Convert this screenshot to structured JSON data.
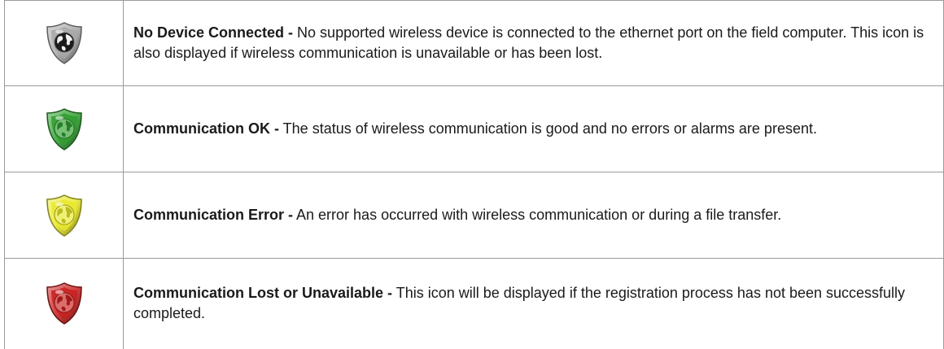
{
  "rows": [
    {
      "icon": "shield-globe-icon-gray",
      "color": "#a8a8a8",
      "title": "No Device Connected -",
      "description": " No supported wireless device is connected to the ethernet port on the field computer. This icon is also displayed if wireless communication is unavailable or has been lost."
    },
    {
      "icon": "shield-globe-icon-green",
      "color": "#2f9e2f",
      "title": "Communication OK -",
      "description": " The status of wireless communication is good and no errors or alarms are present."
    },
    {
      "icon": "shield-globe-icon-yellow",
      "color": "#e8e82a",
      "title": "Communication Error -",
      "description": " An error has occurred with wireless communication or during a file transfer."
    },
    {
      "icon": "shield-globe-icon-red",
      "color": "#c8201e",
      "title": "Communication Lost or Unavailable -",
      "description": " This icon will be displayed if the registration process has not been successfully completed."
    }
  ]
}
